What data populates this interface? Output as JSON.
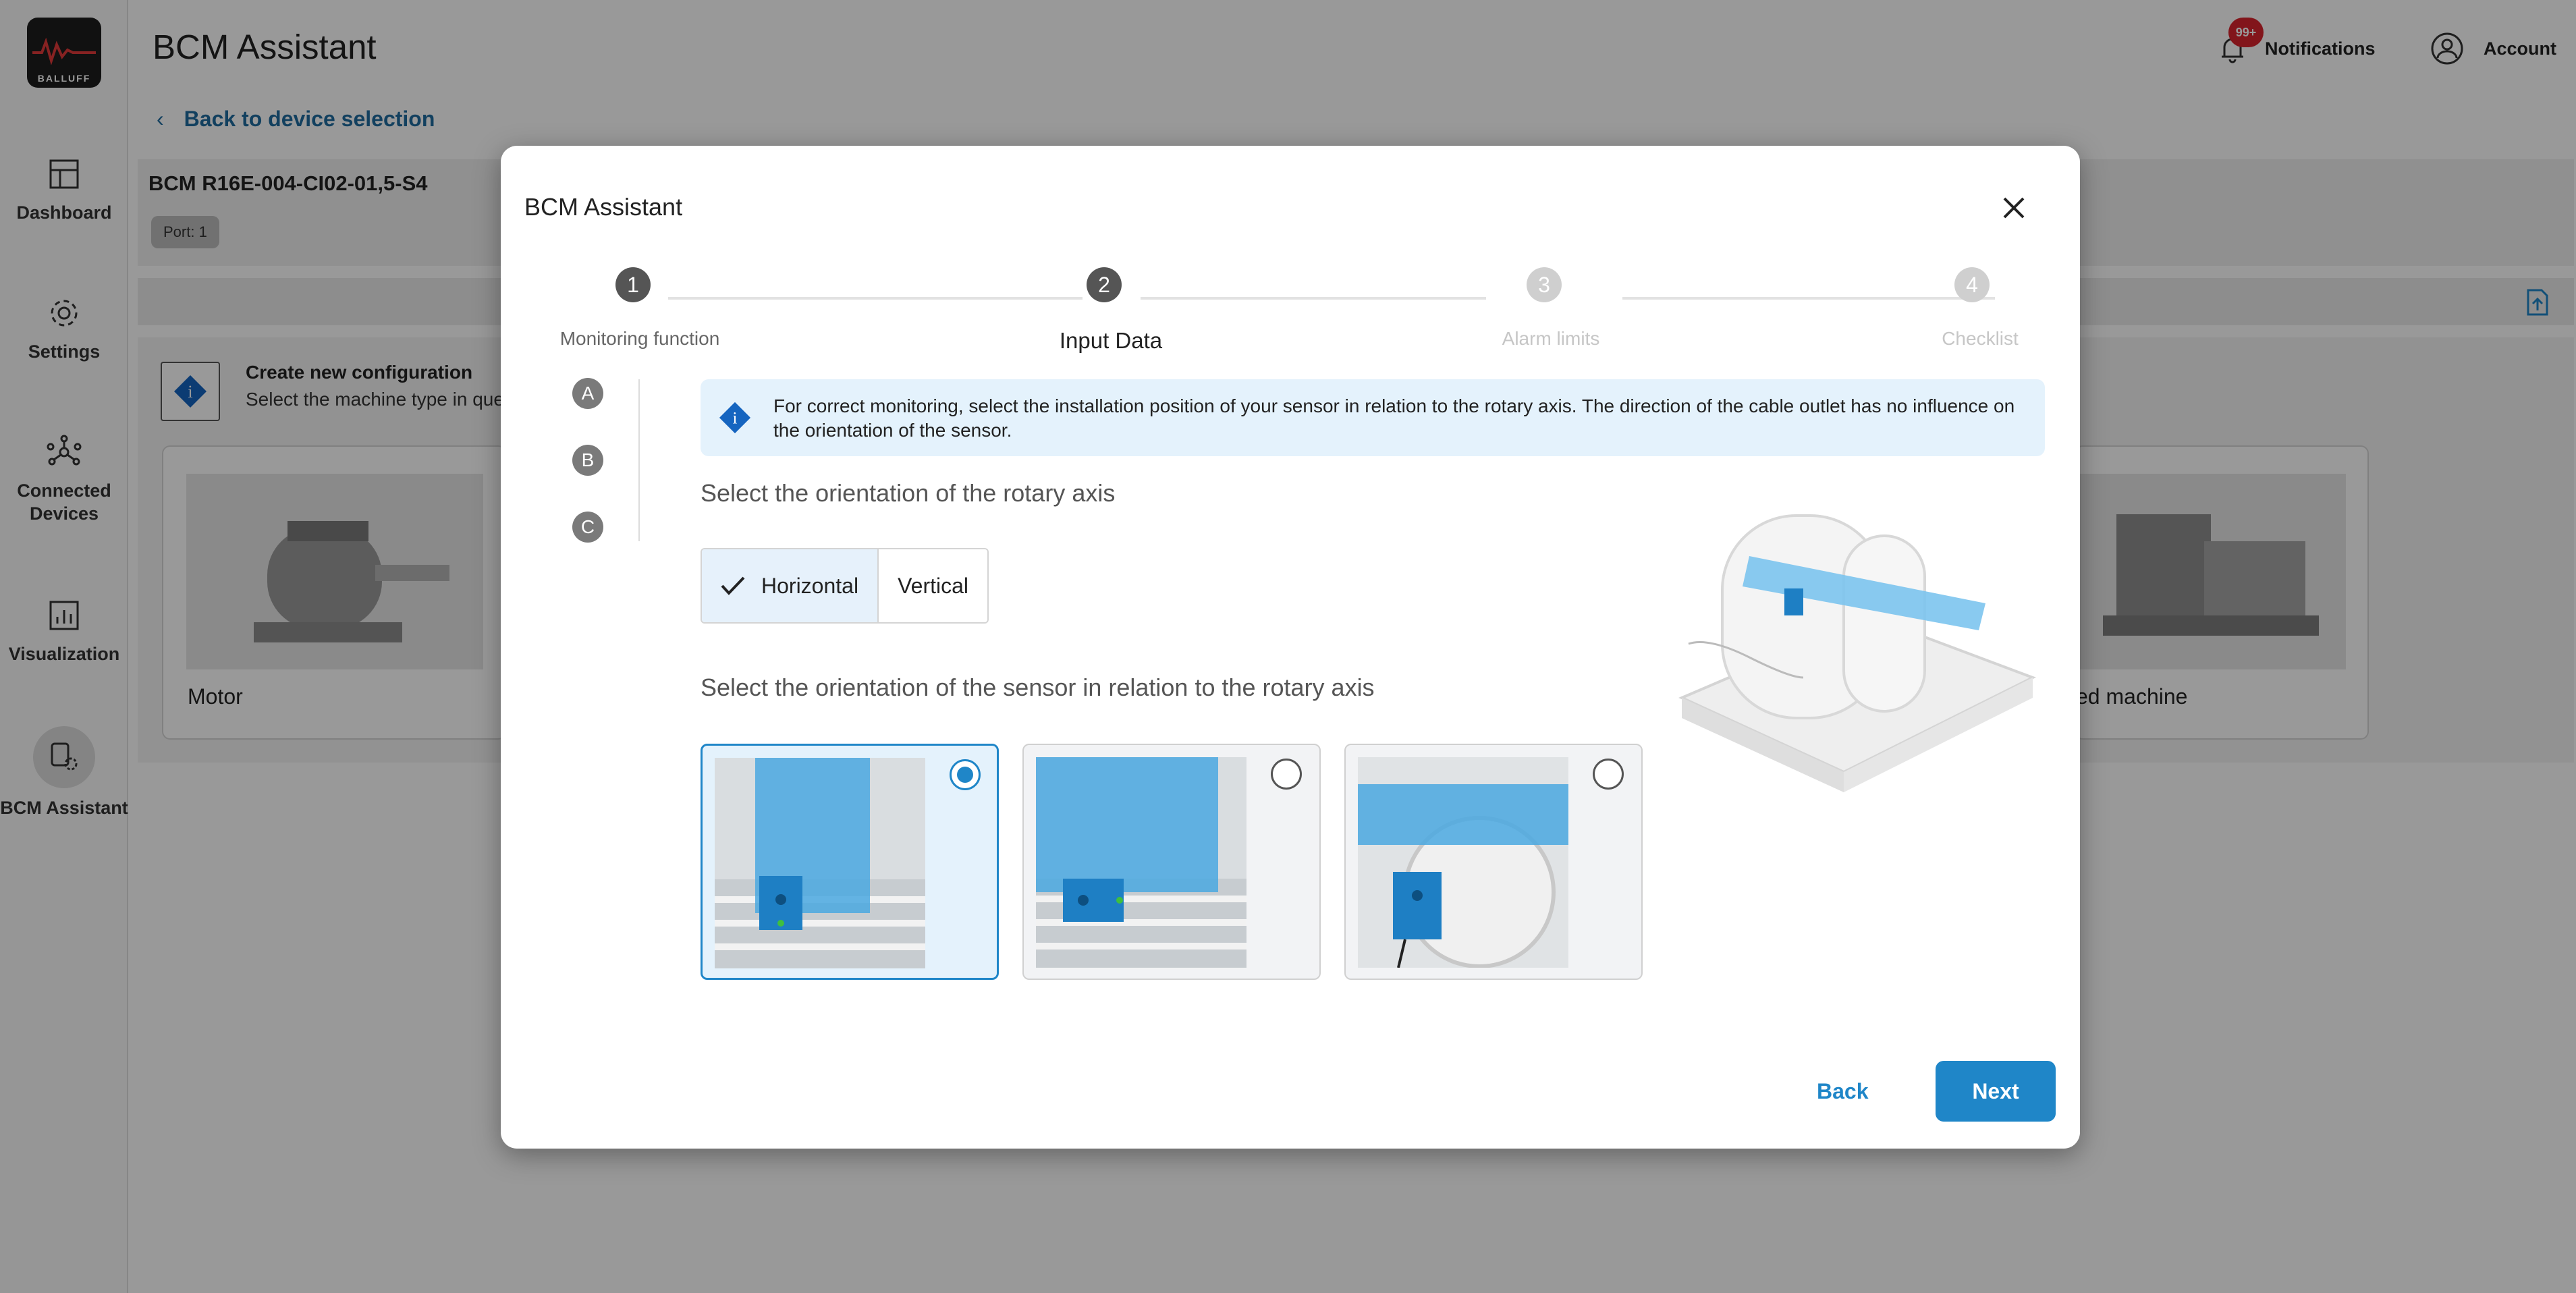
{
  "app": {
    "title": "BCM Assistant",
    "brand": "BALLUFF"
  },
  "header": {
    "notifications_label": "Notifications",
    "notifications_badge": "99+",
    "account_label": "Account"
  },
  "sidebar": {
    "items": [
      {
        "label": "Dashboard",
        "icon": "dashboard-icon"
      },
      {
        "label": "Settings",
        "icon": "gear-icon"
      },
      {
        "label": "Connected Devices",
        "icon": "network-icon"
      },
      {
        "label": "Visualization",
        "icon": "chart-icon"
      },
      {
        "label": "BCM Assistant",
        "icon": "assistant-icon",
        "active": true
      }
    ]
  },
  "page": {
    "back_link": "Back to device selection",
    "device_name": "BCM R16E-004-CI02-01,5-S4",
    "port": "Port: 1",
    "create_title": "Create new configuration",
    "create_subtitle": "Select the machine type in que",
    "machines": [
      {
        "label": "Motor"
      },
      {
        "label": "ed machine"
      }
    ]
  },
  "dialog": {
    "title": "BCM Assistant",
    "steps": [
      {
        "number": "1",
        "label": "Monitoring function",
        "state": "past"
      },
      {
        "number": "2",
        "label": "Input Data",
        "state": "current"
      },
      {
        "number": "3",
        "label": "Alarm limits",
        "state": "future"
      },
      {
        "number": "4",
        "label": "Checklist",
        "state": "future"
      }
    ],
    "sub_steps": [
      "A",
      "B",
      "C"
    ],
    "info_text": "For correct monitoring, select the installation position of your sensor in relation to the rotary axis. The direction of the cable outlet has no influence on the orientation of the sensor.",
    "axis_title": "Select the orientation of the rotary axis",
    "axis_options": [
      {
        "label": "Horizontal",
        "selected": true
      },
      {
        "label": "Vertical",
        "selected": false
      }
    ],
    "sensor_title": "Select the orientation of the sensor in relation to the rotary axis",
    "sensor_options": [
      {
        "selected": true
      },
      {
        "selected": false
      },
      {
        "selected": false
      }
    ],
    "back_label": "Back",
    "next_label": "Next"
  },
  "colors": {
    "accent": "#1f86c8",
    "link": "#1f6b9e",
    "badge": "#d9232e",
    "info_bg": "#e4f2fc"
  }
}
